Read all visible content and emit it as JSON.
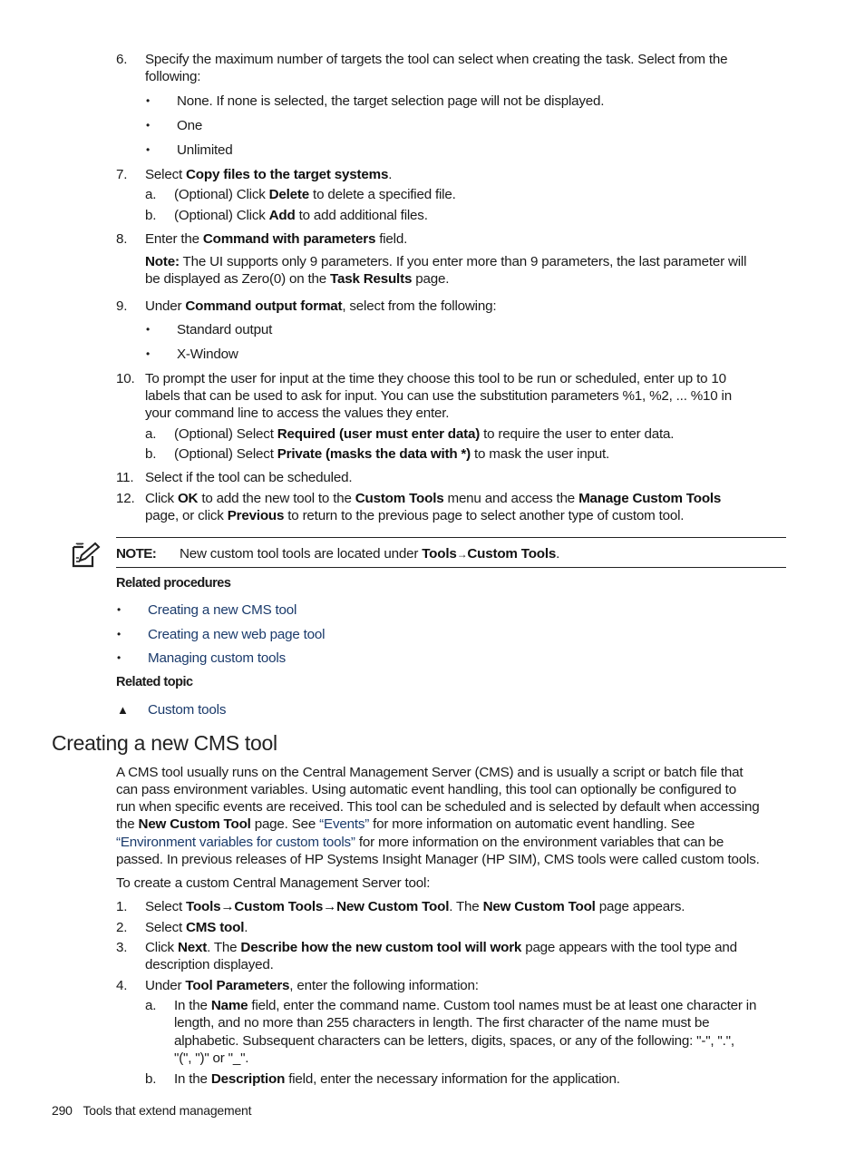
{
  "step6": {
    "num": "6.",
    "text_line1": "Specify the maximum number of targets the tool can select when creating the task. Select from the",
    "text_line2": "following:",
    "options": [
      "None. If none is selected, the target selection page will not be displayed.",
      "One",
      "Unlimited"
    ]
  },
  "step7": {
    "num": "7.",
    "pre": "Select ",
    "bold": "Copy files to the target systems",
    "post": ".",
    "sub_a": {
      "label": "a.",
      "pre": "(Optional) Click ",
      "bold": "Delete",
      "post": " to delete a specified file."
    },
    "sub_b": {
      "label": "b.",
      "pre": "(Optional) Click ",
      "bold": "Add",
      "post": " to add additional files."
    }
  },
  "step8": {
    "num": "8.",
    "pre": "Enter the ",
    "bold": "Command with parameters",
    "post": " field.",
    "note_label": "Note:",
    "note_line1": " The UI supports only 9 parameters. If you enter more than 9 parameters, the last parameter will",
    "note_line2_pre": "be displayed as Zero(0) on the ",
    "note_line2_bold": "Task Results",
    "note_line2_post": " page."
  },
  "step9": {
    "num": "9.",
    "pre": "Under ",
    "bold": "Command output format",
    "post": ", select from the following:",
    "options": [
      "Standard output",
      "X-Window"
    ]
  },
  "step10": {
    "num": "10.",
    "line1": "To prompt the user for input at the time they choose this tool to be run or scheduled, enter up to 10",
    "line2": "labels that can be used to ask for input. You can use the substitution parameters %1, %2, ... %10 in",
    "line3": "your command line to access the values they enter.",
    "sub_a": {
      "label": "a.",
      "pre": "(Optional) Select ",
      "bold": "Required (user must enter data)",
      "post": " to require the user to enter data."
    },
    "sub_b": {
      "label": "b.",
      "pre": "(Optional) Select ",
      "bold": "Private (masks the data with *)",
      "post": " to mask the user input."
    }
  },
  "step11": {
    "num": "11.",
    "text": "Select if the tool can be scheduled."
  },
  "step12": {
    "num": "12.",
    "l1_a": "Click ",
    "l1_b": "OK",
    "l1_c": " to add the new tool to the ",
    "l1_d": "Custom Tools",
    "l1_e": " menu and access the ",
    "l1_f": "Manage Custom Tools",
    "l2_a": "page, or click ",
    "l2_b": "Previous",
    "l2_c": " to return to the previous page to select another type of custom tool."
  },
  "note": {
    "label": "NOTE:",
    "pre": "New custom tool tools are located under ",
    "bold1": "Tools",
    "arrow": "→",
    "bold2": "Custom Tools",
    "post": "."
  },
  "related_procedures": {
    "heading": "Related procedures",
    "links": [
      "Creating a new CMS tool",
      "Creating a new web page tool",
      "Managing custom tools"
    ]
  },
  "related_topic": {
    "heading": "Related topic",
    "links": [
      "Custom tools"
    ]
  },
  "section": {
    "title": "Creating a new CMS tool",
    "p1_l1": "A CMS tool usually runs on the Central Management Server (CMS) and is usually a script or batch file that",
    "p1_l2": "can pass environment variables. Using automatic event handling, this tool can optionally be configured to",
    "p1_l3": "run when specific events are received. This tool can be scheduled and is selected by default when accessing",
    "p1_l4_a": "the ",
    "p1_l4_b": "New Custom Tool",
    "p1_l4_c": " page. See ",
    "p1_l4_link": "“Events”",
    "p1_l4_d": " for more information on automatic event handling. See",
    "p1_l5_link": "“Environment variables for custom tools”",
    "p1_l5_b": " for more information on the environment variables that can be",
    "p1_l6": "passed. In previous releases of HP Systems Insight Manager (HP SIM), CMS tools were called custom tools.",
    "intro": "To create a custom Central Management Server tool:",
    "s1": {
      "num": "1.",
      "a": "Select ",
      "b": "Tools→Custom Tools→New Custom Tool",
      "c": ". The ",
      "d": "New Custom Tool",
      "e": " page appears."
    },
    "s2": {
      "num": "2.",
      "a": "Select ",
      "b": "CMS tool",
      "c": "."
    },
    "s3": {
      "num": "3.",
      "a": "Click ",
      "b": "Next",
      "c": ". The ",
      "d": "Describe how the new custom tool will work",
      "e": " page appears with the tool type and",
      "l2": "description displayed."
    },
    "s4": {
      "num": "4.",
      "a": "Under ",
      "b": "Tool Parameters",
      "c": ", enter the following information:"
    },
    "s4a": {
      "label": "a.",
      "a": "In the ",
      "b": "Name",
      "c": " field, enter the command name. Custom tool names must be at least one character in",
      "l2": "length, and no more than 255 characters in length. The first character of the name must be",
      "l3": "alphabetic. Subsequent characters can be letters, digits, spaces, or any of the following: \"-\", \".\",",
      "l4": "\"(\", \")\" or \"_\"."
    },
    "s4b": {
      "label": "b.",
      "a": "In the ",
      "b": "Description",
      "c": " field, enter the necessary information for the application."
    }
  },
  "footer": {
    "page_number": "290",
    "section": "Tools that extend management"
  }
}
